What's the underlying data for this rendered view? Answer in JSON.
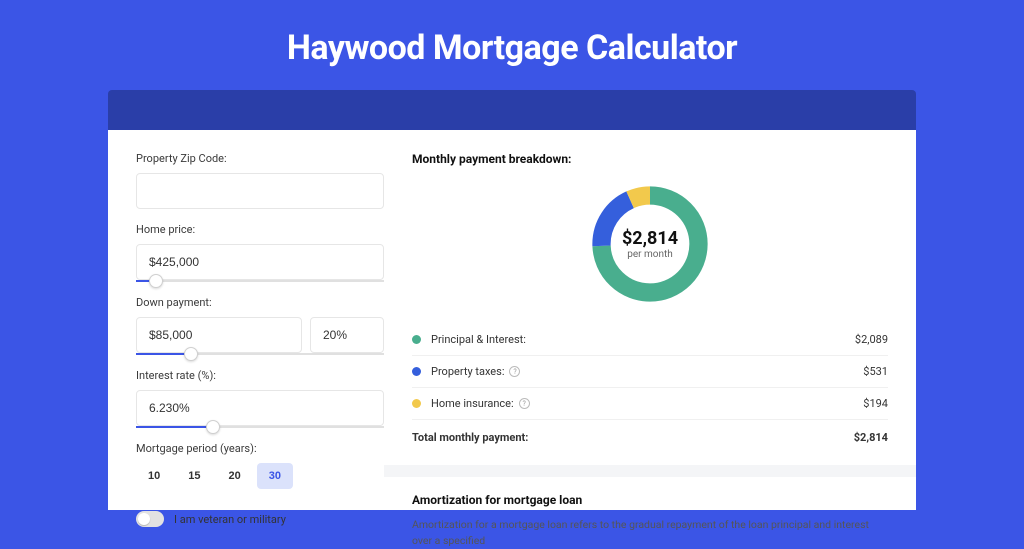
{
  "title": "Haywood Mortgage Calculator",
  "form": {
    "zip": {
      "label": "Property Zip Code:",
      "value": ""
    },
    "home_price": {
      "label": "Home price:",
      "value": "$425,000",
      "slider_pct": 8
    },
    "down_payment": {
      "label": "Down payment:",
      "value": "$85,000",
      "pct_value": "20%",
      "slider_pct": 22
    },
    "interest": {
      "label": "Interest rate (%):",
      "value": "6.230%",
      "slider_pct": 31
    },
    "period": {
      "label": "Mortgage period (years):",
      "options": [
        "10",
        "15",
        "20",
        "30"
      ],
      "selected": "30"
    },
    "veteran": {
      "label": "I am veteran or military",
      "checked": false
    }
  },
  "breakdown": {
    "title": "Monthly payment breakdown:",
    "center_amount": "$2,814",
    "center_sub": "per month",
    "items": [
      {
        "label": "Principal & Interest:",
        "value": "$2,089",
        "color": "#49ae8e",
        "info": false
      },
      {
        "label": "Property taxes:",
        "value": "$531",
        "color": "#355fdc",
        "info": true
      },
      {
        "label": "Home insurance:",
        "value": "$194",
        "color": "#f2c94c",
        "info": true
      }
    ],
    "total": {
      "label": "Total monthly payment:",
      "value": "$2,814"
    }
  },
  "chart_data": {
    "type": "pie",
    "title": "Monthly payment breakdown",
    "series": [
      {
        "name": "Principal & Interest",
        "value": 2089,
        "color": "#49ae8e"
      },
      {
        "name": "Property taxes",
        "value": 531,
        "color": "#355fdc"
      },
      {
        "name": "Home insurance",
        "value": 194,
        "color": "#f2c94c"
      }
    ],
    "total": 2814,
    "center_label": "$2,814 per month"
  },
  "amortization": {
    "title": "Amortization for mortgage loan",
    "text": "Amortization for a mortgage loan refers to the gradual repayment of the loan principal and interest over a specified"
  }
}
